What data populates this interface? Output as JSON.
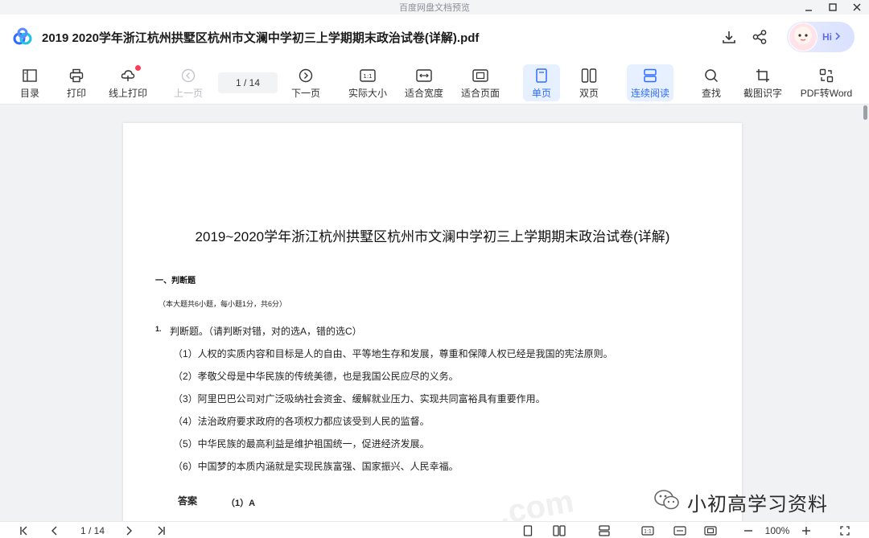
{
  "window": {
    "os_title": "百度网盘文档预览"
  },
  "header": {
    "file_title": "2019 2020学年浙江杭州拱墅区杭州市文澜中学初三上学期期末政治试卷(详解).pdf",
    "assistant_label": "Hi"
  },
  "toolbar": {
    "toc": "目录",
    "print": "打印",
    "online_print": "线上打印",
    "prev_page": "上一页",
    "page_indicator": "1 / 14",
    "next_page": "下一页",
    "actual_size": "实际大小",
    "fit_width": "适合宽度",
    "fit_page": "适合页面",
    "single_page": "单页",
    "double_page": "双页",
    "continuous": "连续阅读",
    "find": "查找",
    "ocr": "截图识字",
    "pdf_to_word": "PDF转Word"
  },
  "document": {
    "title": "2019~2020学年浙江杭州拱墅区杭州市文澜中学初三上学期期末政治试卷(详解)",
    "section_title": "一、判断题",
    "section_note": "（本大题共6小题，每小题1分，共6分）",
    "question_number": "1.",
    "question_text": "判断题。（请判断对错，对的选A，错的选C）",
    "items": [
      "（1）人权的实质内容和目标是人的自由、平等地生存和发展，尊重和保障人权已经是我国的宪法原则。",
      "（2）孝敬父母是中华民族的传统美德，也是我国公民应尽的义务。",
      "（3）阿里巴巴公司对广泛吸纳社会资金、缓解就业压力、实现共同富裕具有重要作用。",
      "（4）法治政府要求政府的各项权力都应该受到人民的监督。",
      "（5）中华民族的最高利益是维护祖国统一，促进经济发展。",
      "（6）中国梦的本质内涵就是实现民族富强、国家振兴、人民幸福。"
    ],
    "answer_label": "答案",
    "answer_value": "（1）A",
    "watermark": "小初高学习资料",
    "watermark_bg": ".com"
  },
  "bottom_bar": {
    "page_indicator": "1 / 14",
    "zoom": "100%"
  },
  "colors": {
    "accent": "#2e6bff",
    "active_bg": "#e6f0ff",
    "notification_dot": "#ff3b5c"
  }
}
